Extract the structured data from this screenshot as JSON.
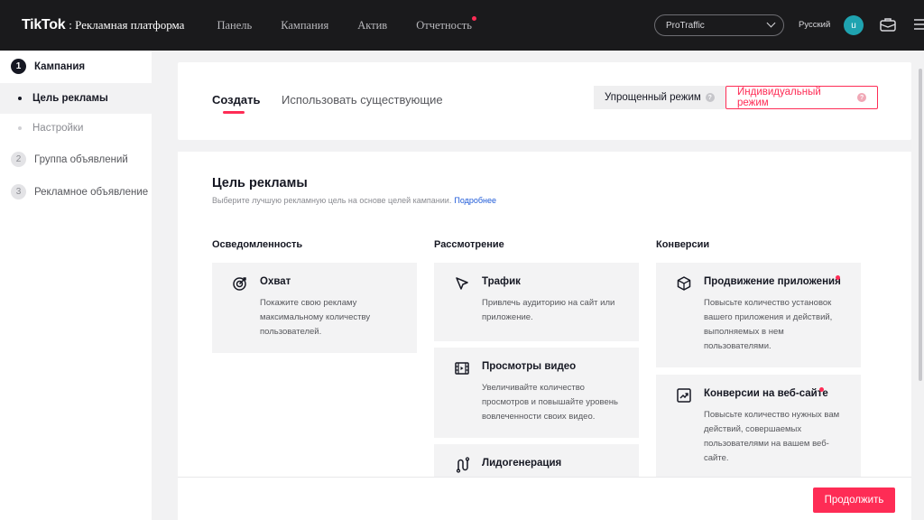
{
  "header": {
    "brand": "TikTok",
    "brand_suffix": ": Рекламная платформа",
    "nav": [
      "Панель",
      "Кампания",
      "Актив",
      "Отчетность"
    ],
    "account": "ProTraffic",
    "language": "Русский",
    "avatar_letter": "u"
  },
  "sidebar": {
    "steps": [
      {
        "num": "1",
        "label": "Кампания"
      },
      {
        "num": "2",
        "label": "Группа объявлений"
      },
      {
        "num": "3",
        "label": "Рекламное объявление"
      }
    ],
    "substeps": [
      "Цель рекламы",
      "Настройки"
    ]
  },
  "top_card": {
    "tabs": [
      "Создать",
      "Использовать существующие"
    ],
    "mode_simple": "Упрощенный режим",
    "mode_custom": "Индивидуальный режим",
    "help_glyph": "?"
  },
  "objective": {
    "title": "Цель рекламы",
    "description": "Выберите лучшую рекламную цель на основе целей кампании.",
    "link": "Подробнее",
    "columns": [
      {
        "heading": "Осведомленность",
        "items": [
          {
            "title": "Охват",
            "desc": "Покажите свою рекламу максимальному количеству пользователей.",
            "icon": "reach-icon"
          }
        ]
      },
      {
        "heading": "Рассмотрение",
        "items": [
          {
            "title": "Трафик",
            "desc": "Привлечь аудиторию на сайт или приложение.",
            "icon": "cursor-icon"
          },
          {
            "title": "Просмотры видео",
            "desc": "Увеличивайте количество просмотров и повышайте уровень вовлеченности своих видео.",
            "icon": "film-icon"
          },
          {
            "title": "Лидогенерация",
            "desc": "",
            "icon": "lead-icon"
          }
        ]
      },
      {
        "heading": "Конверсии",
        "items": [
          {
            "title": "Продвижение приложения",
            "desc": "Повысьте количество установок вашего приложения и действий, выполняемых в нем пользователями.",
            "icon": "cube-icon"
          },
          {
            "title": "Конверсии на веб-сайте",
            "desc": "Повысьте количество нужных вам действий, совершаемых пользователями на вашем веб-сайте.",
            "icon": "trend-icon"
          }
        ]
      }
    ]
  },
  "footer": {
    "continue": "Продолжить"
  },
  "colors": {
    "accent": "#fe2c55",
    "topbar": "#1a1a1c",
    "link": "#1f5bd8"
  }
}
